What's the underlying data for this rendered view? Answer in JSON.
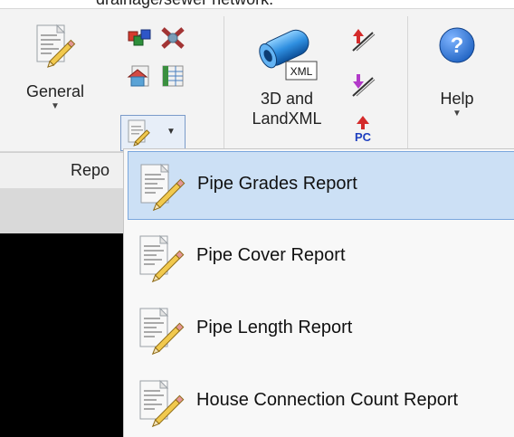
{
  "header": {
    "clipped_text": "drainage/sewer network."
  },
  "ribbon": {
    "general": {
      "label": "General",
      "icon": "report-pencil-icon"
    },
    "small_icons": [
      "network-cubes-icon",
      "cross-pipe-icon",
      "house-report-icon",
      "table-report-icon"
    ],
    "split": {
      "icon": "report-pencil-icon"
    },
    "three_d": {
      "label_line1": "3D and",
      "label_line2": "LandXML",
      "icon_badge": "XML"
    },
    "right_small": [
      "pipe-arrow-red-icon",
      "pipe-arrow-purple-icon",
      "pc-arrow-icon"
    ],
    "right_small_badge": "PC",
    "help": {
      "label": "Help",
      "icon": "help-icon",
      "glyph": "?"
    }
  },
  "group": {
    "label": "Repo"
  },
  "menu": {
    "items": [
      {
        "label": "Pipe Grades Report",
        "selected": true,
        "icon": "report-pencil-icon"
      },
      {
        "label": "Pipe Cover Report",
        "selected": false,
        "icon": "report-pencil-icon"
      },
      {
        "label": "Pipe Length Report",
        "selected": false,
        "icon": "report-pencil-icon"
      },
      {
        "label": "House Connection Count Report",
        "selected": false,
        "icon": "report-pencil-icon"
      }
    ]
  },
  "colors": {
    "selection_bg": "#cce0f5",
    "selection_border": "#7aa7dd",
    "help_blue": "#1b5fbf"
  }
}
